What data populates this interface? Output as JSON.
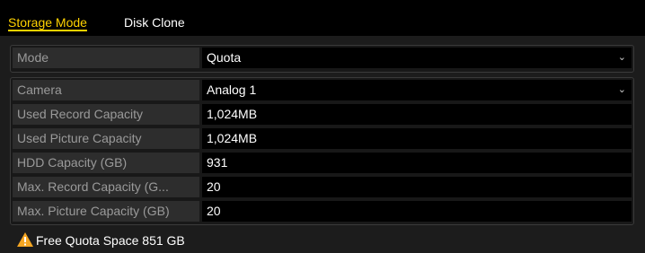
{
  "tabs": [
    {
      "label": "Storage Mode",
      "active": true
    },
    {
      "label": "Disk Clone",
      "active": false
    }
  ],
  "mode": {
    "label": "Mode",
    "value": "Quota"
  },
  "camera": {
    "label": "Camera",
    "value": "Analog 1"
  },
  "details": [
    {
      "label": "Used Record Capacity",
      "value": "1,024MB"
    },
    {
      "label": "Used Picture Capacity",
      "value": "1,024MB"
    },
    {
      "label": "HDD Capacity (GB)",
      "value": "931"
    },
    {
      "label": "Max. Record Capacity (G...",
      "value": "20"
    },
    {
      "label": "Max. Picture Capacity (GB)",
      "value": "20"
    }
  ],
  "footer": {
    "icon": "warning-icon",
    "text": "Free Quota Space 851 GB"
  },
  "colors": {
    "accent": "#ffd200",
    "warning": "#f5a623",
    "background": "#1c1c1c"
  }
}
